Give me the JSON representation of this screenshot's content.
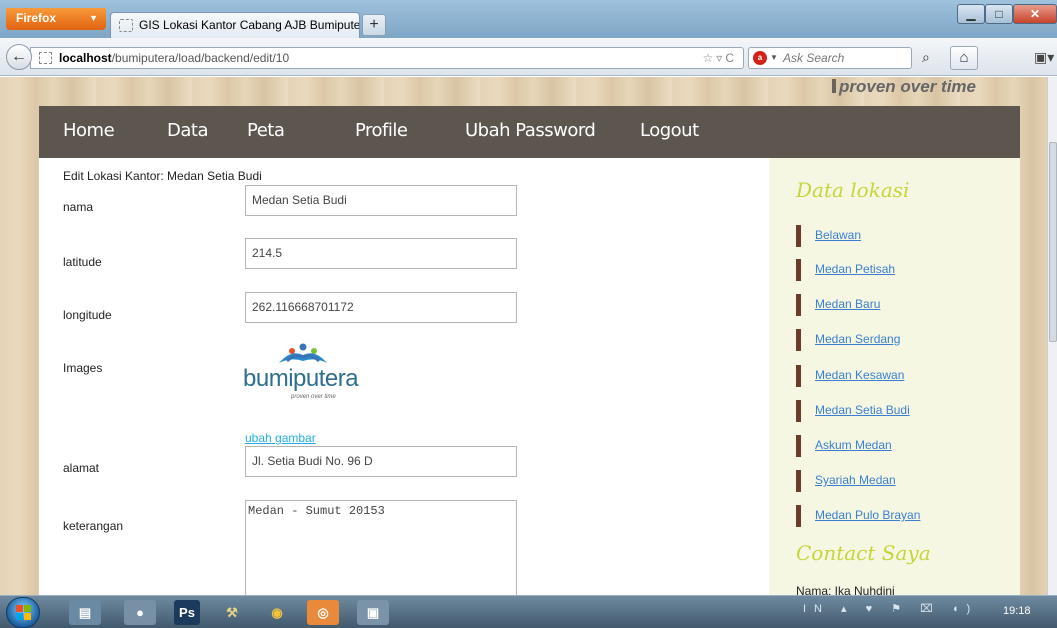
{
  "browser": {
    "app_button": "Firefox",
    "tab_title": "GIS Lokasi Kantor Cabang AJB Bumipute...",
    "new_tab": "+",
    "url_host": "localhost",
    "url_path": "/bumiputera/load/backend/edit/10",
    "search_placeholder": "Ask Search",
    "search_engine_icon": "ask-icon"
  },
  "site": {
    "tagline": "proven over time",
    "menu": [
      "Home",
      "Data",
      "Peta",
      "Profile",
      "Ubah Password",
      "Logout"
    ]
  },
  "form": {
    "title": "Edit Lokasi Kantor: Medan Setia Budi",
    "nama_label": "nama",
    "nama_value": "Medan Setia Budi",
    "latitude_label": "latitude",
    "latitude_value": "214.5",
    "longitude_label": "longitude",
    "longitude_value": "262.116668701172",
    "images_label": "Images",
    "logo_text": "bumiputera",
    "logo_subtext": "proven over time",
    "change_image_link": "ubah gambar",
    "alamat_label": "alamat",
    "alamat_value": "Jl. Setia Budi No. 96 D",
    "keterangan_label": "keterangan",
    "keterangan_value": "Medan - Sumut 20153"
  },
  "sidebar": {
    "title": "Data lokasi",
    "items": [
      "Belawan",
      "Medan Petisah",
      "Medan Baru",
      "Medan Serdang",
      "Medan Kesawan",
      "Medan Setia Budi",
      "Askum Medan",
      "Syariah Medan",
      "Medan Pulo Brayan"
    ],
    "contact_title": "Contact Saya",
    "contact_name": "Nama: Ika Nuhdini"
  },
  "taskbar": {
    "tray_lang": "IN",
    "clock": "19:18",
    "colors": {
      "accent": "#5d564f",
      "sidebar_bg": "#f5f7e2",
      "link": "#3b7fd0"
    }
  }
}
